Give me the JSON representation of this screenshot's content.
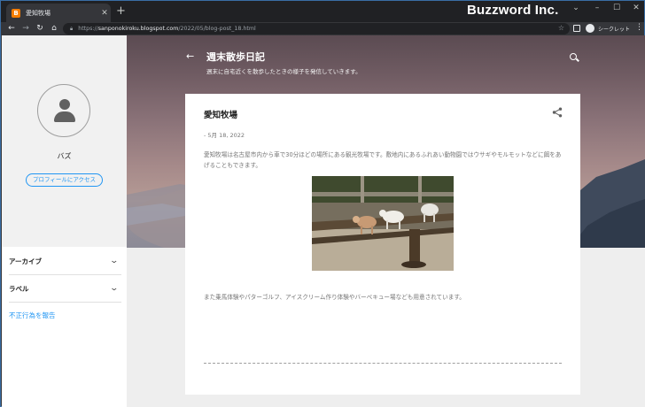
{
  "browser": {
    "tab_title": "愛知牧場",
    "tab_favicon": "B",
    "url_host": "sanponokiroku.blogspot.com",
    "url_path": "/2022/05/blog-post_18.html",
    "url_scheme": "https://",
    "incognito_label": "シークレット",
    "brand_watermark": "Buzzword Inc."
  },
  "sidebar": {
    "profile_name": "バズ",
    "profile_button": "プロフィールにアクセス",
    "sections": [
      {
        "label": "アーカイブ"
      },
      {
        "label": "ラベル"
      }
    ],
    "report_link": "不正行為を報告"
  },
  "header": {
    "blog_title": "週末散歩日記",
    "blog_description": "週末に自宅近くを散歩したときの様子を発信していきます。"
  },
  "post": {
    "title": "愛知牧場",
    "date": "- 5月 18, 2022",
    "paragraph1": "愛知牧場は名古屋市内から車で30分ほどの場所にある観光牧場です。敷地内にあるふれあい動物園ではウサギやモルモットなどに餌をあげることもできます。",
    "paragraph2": "また乗馬体験やパターゴルフ、アイスクリーム作り体験やバーベキュー場なども用意されています。"
  },
  "colors": {
    "accent_blue": "#2196f3",
    "chrome_dark": "#202124",
    "chrome_toolbar": "#35363a"
  }
}
